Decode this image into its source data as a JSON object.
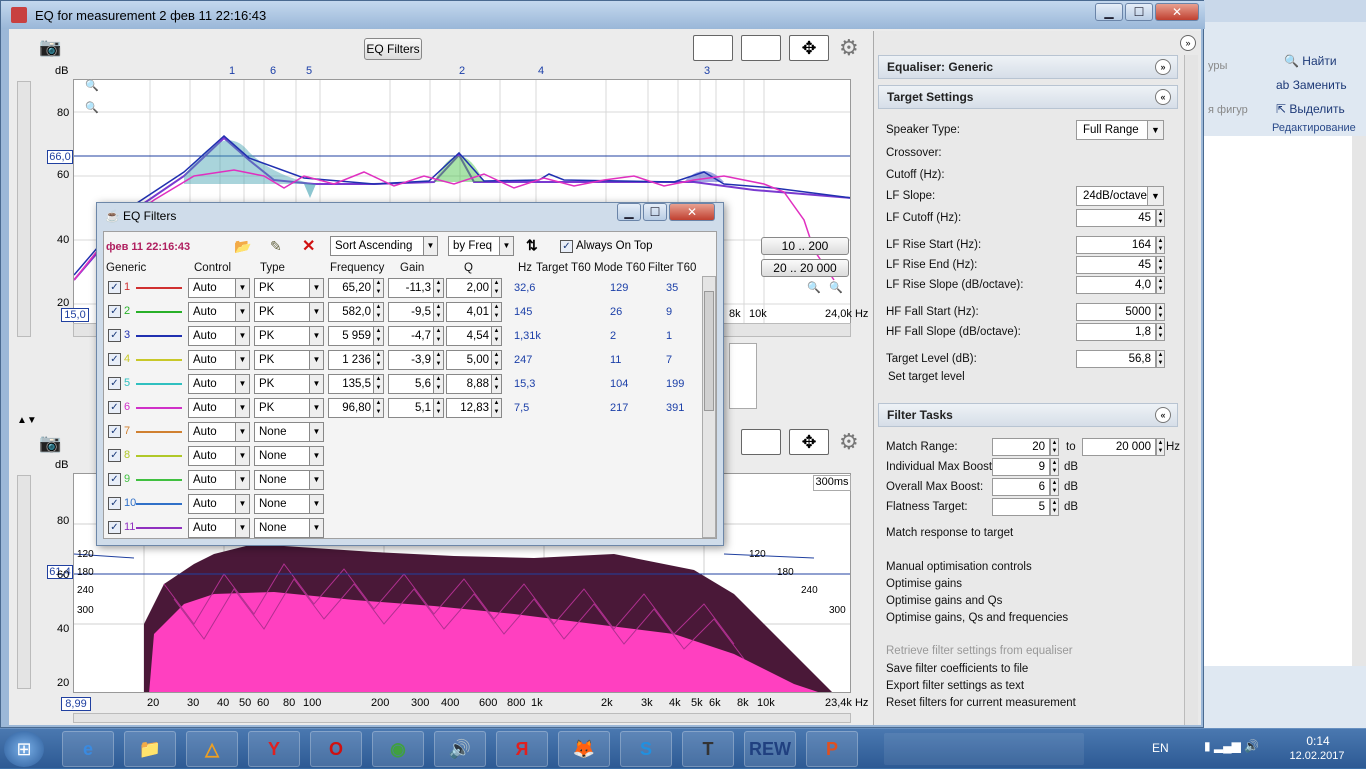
{
  "window": {
    "title": "EQ for measurement 2 фев 11 22:16:43",
    "min": "▁",
    "max": "☐",
    "close": "✕"
  },
  "graph_top": {
    "ylabel": "dB",
    "yticks": [
      "80",
      "60",
      "40",
      "20"
    ],
    "cursor_db": "66,0",
    "min_freq": "15,0",
    "peak_labels": [
      "1",
      "6",
      "5",
      "2",
      "4",
      "3"
    ],
    "xticks_right": [
      "8k",
      "10k"
    ],
    "max_freq": "24,0k Hz",
    "eq_filters_button": "EQ Filters",
    "range_buttons": [
      "10 .. 200",
      "20 .. 20 000"
    ]
  },
  "graph_bottom": {
    "ylabel": "dB",
    "yticks": [
      "80",
      "60",
      "40",
      "20"
    ],
    "cursor_db": "61,4",
    "min_freq": "8,99",
    "time_label": "300ms",
    "depth_labels": [
      "120",
      "180",
      "240",
      "300"
    ],
    "xticks": [
      "20",
      "30",
      "40",
      "50",
      "60",
      "80",
      "100",
      "200",
      "300",
      "400",
      "600",
      "800",
      "1k",
      "2k",
      "3k",
      "4k",
      "5k",
      "6k",
      "8k",
      "10k"
    ],
    "max_freq": "23,4k Hz"
  },
  "eq_dialog": {
    "title": "EQ Filters",
    "measurement": "фев 11 22:16:43",
    "sort": "Sort Ascending",
    "sort_by": "by Freq",
    "always_on_top": "Always On Top",
    "headers": [
      "Generic",
      "Control",
      "Type",
      "Frequency",
      "Gain",
      "Q",
      "Hz",
      "Target T60",
      "Mode T60",
      "Filter T60"
    ],
    "filters": [
      {
        "n": "1",
        "color": "#d03030",
        "control": "Auto",
        "type": "PK",
        "freq": "65,20",
        "gain": "-11,3",
        "q": "2,00",
        "hz": "32,6",
        "mode": "129",
        "filter": "35"
      },
      {
        "n": "2",
        "color": "#28b028",
        "control": "Auto",
        "type": "PK",
        "freq": "582,0",
        "gain": "-9,5",
        "q": "4,01",
        "hz": "145",
        "mode": "26",
        "filter": "9"
      },
      {
        "n": "3",
        "color": "#2030b0",
        "control": "Auto",
        "type": "PK",
        "freq": "5 959",
        "gain": "-4,7",
        "q": "4,54",
        "hz": "1,31k",
        "mode": "2",
        "filter": "1"
      },
      {
        "n": "4",
        "color": "#c8c828",
        "control": "Auto",
        "type": "PK",
        "freq": "1 236",
        "gain": "-3,9",
        "q": "5,00",
        "hz": "247",
        "mode": "11",
        "filter": "7"
      },
      {
        "n": "5",
        "color": "#30c0c0",
        "control": "Auto",
        "type": "PK",
        "freq": "135,5",
        "gain": "5,6",
        "q": "8,88",
        "hz": "15,3",
        "mode": "104",
        "filter": "199"
      },
      {
        "n": "6",
        "color": "#d030c8",
        "control": "Auto",
        "type": "PK",
        "freq": "96,80",
        "gain": "5,1",
        "q": "12,83",
        "hz": "7,5",
        "mode": "217",
        "filter": "391"
      },
      {
        "n": "7",
        "color": "#d08030",
        "control": "Auto",
        "type": "None"
      },
      {
        "n": "8",
        "color": "#b0c828",
        "control": "Auto",
        "type": "None"
      },
      {
        "n": "9",
        "color": "#40c040",
        "control": "Auto",
        "type": "None"
      },
      {
        "n": "10",
        "color": "#3070c8",
        "control": "Auto",
        "type": "None"
      },
      {
        "n": "11",
        "color": "#9030c0",
        "control": "Auto",
        "type": "None"
      }
    ]
  },
  "right_panel": {
    "equaliser": "Equaliser: Generic",
    "target_settings": "Target Settings",
    "speaker_type_label": "Speaker Type:",
    "speaker_type": "Full Range",
    "crossover": "Crossover:",
    "cutoff": "Cutoff (Hz):",
    "lf_slope_label": "LF Slope:",
    "lf_slope": "24dB/octave",
    "fields": [
      {
        "label": "LF Cutoff (Hz):",
        "value": "45"
      },
      {
        "label": "LF Rise Start (Hz):",
        "value": "164"
      },
      {
        "label": "LF Rise End (Hz):",
        "value": "45"
      },
      {
        "label": "LF Rise Slope (dB/octave):",
        "value": "4,0"
      },
      {
        "label": "HF Fall Start (Hz):",
        "value": "5000"
      },
      {
        "label": "HF Fall Slope (dB/octave):",
        "value": "1,8"
      },
      {
        "label": "Target Level (dB):",
        "value": "56,8"
      }
    ],
    "set_target": "Set target level",
    "filter_tasks": "Filter Tasks",
    "match_range_label": "Match Range:",
    "match_from": "20",
    "to": "to",
    "match_to": "20 000",
    "hz": "Hz",
    "ind_boost_label": "Individual Max Boost:",
    "ind_boost": "9",
    "overall_boost_label": "Overall Max Boost:",
    "overall_boost": "6",
    "flatness_label": "Flatness Target:",
    "flatness": "5",
    "db": "dB",
    "match_response": "Match response to target",
    "manual": "Manual optimisation controls",
    "opt_gains": "Optimise gains",
    "opt_gains_qs": "Optimise gains and Qs",
    "opt_all": "Optimise gains, Qs and frequencies",
    "retrieve": "Retrieve filter settings from equaliser",
    "save_coeff": "Save filter coefficients to file",
    "export": "Export filter settings as text",
    "reset": "Reset filters for current measurement"
  },
  "bg_app": {
    "find": "Найти",
    "replace": "Заменить",
    "select": "Выделить",
    "editing": "Редактирование",
    "figures": "уры",
    "figures2": "я фигур"
  },
  "taskbar": {
    "lang": "EN",
    "time": "0:14",
    "date": "12.02.2017",
    "apps": [
      "e",
      "📁",
      "△",
      "Y",
      "O",
      "◉",
      "🔊",
      "Я",
      "🦊",
      "S",
      "T",
      "REW",
      "P"
    ]
  }
}
